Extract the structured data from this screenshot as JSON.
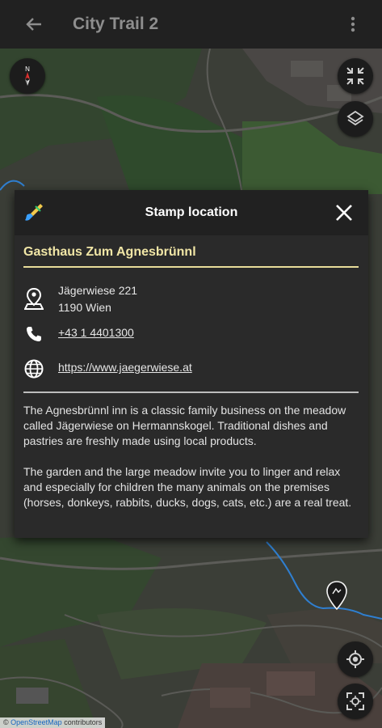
{
  "appbar": {
    "title": "City Trail 2",
    "back_icon": "arrow-left-icon",
    "more_icon": "more-vert-icon"
  },
  "map": {
    "attribution_prefix": "©",
    "attribution_link": "OpenStreetMap",
    "attribution_suffix": "contributors",
    "controls": {
      "compass_icon": "compass-icon",
      "collapse_icon": "fullscreen-exit-icon",
      "layers_icon": "layers-icon",
      "locate_icon": "my-location-icon",
      "gps_icon": "gps-crosshair-icon"
    }
  },
  "dialog": {
    "title": "Stamp location",
    "place_name": "Gasthaus Zum Agnesbrünnl",
    "address_line1": "Jägerwiese 221",
    "address_line2": "1190 Wien",
    "phone": "+43 1 4401300",
    "website": "https://www.jaegerwiese.at",
    "description_p1": "The Agnesbrünnl inn is a classic family business on the meadow called Jägerwiese on Hermannskogel. Traditional dishes and pastries are freshly made using local products.",
    "description_p2": "The garden and the large meadow invite you to linger and relax and especially for children the many animals on the premises (horses, donkeys, rabbits, ducks, dogs, cats, etc.) are a real treat."
  },
  "colors": {
    "accent": "#f1e6a6",
    "appbar": "#212121",
    "dialog_bg": "#2a2a2a",
    "river": "#2f7fd0"
  }
}
